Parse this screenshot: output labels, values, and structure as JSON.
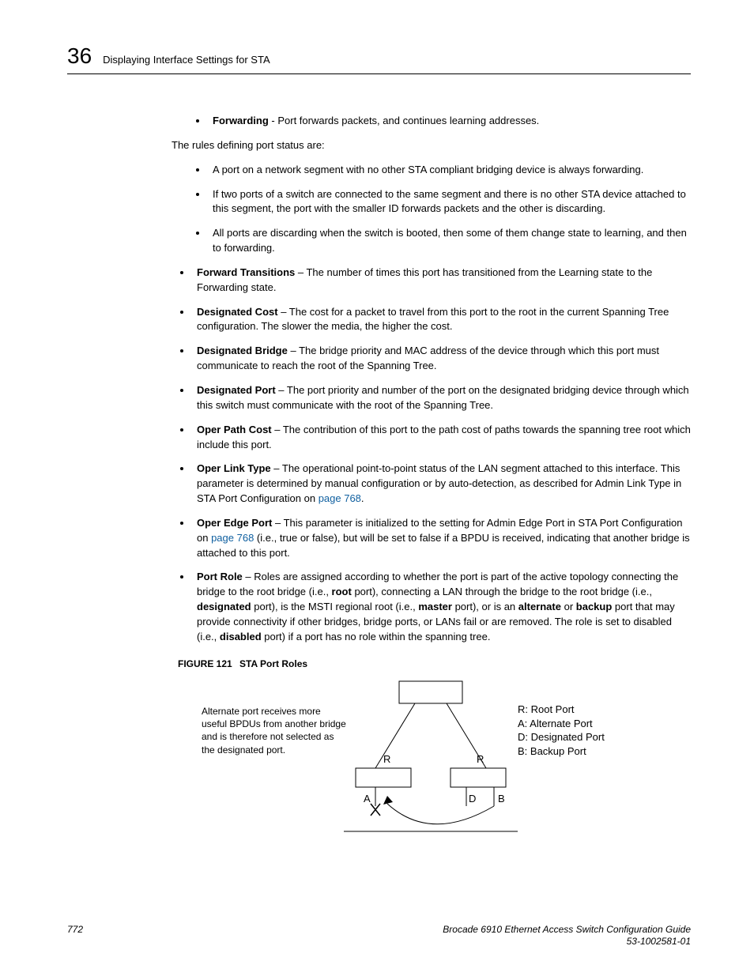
{
  "header": {
    "chapter_no": "36",
    "chapter_title": "Displaying Interface Settings for STA"
  },
  "body": {
    "forwarding_term": "Forwarding",
    "forwarding_desc": " - Port forwards packets, and continues learning addresses.",
    "rules_intro": "The rules defining port status are:",
    "rule1": "A port on a network segment with no other STA compliant bridging device is always forwarding.",
    "rule2": "If two ports of a switch are connected to the same segment and there is no other STA device attached to this segment, the port with the smaller ID forwards packets and the other is discarding.",
    "rule3": "All ports are discarding when the switch is booted, then some of them change state to learning, and then to forwarding.",
    "ft_term": "Forward Transitions",
    "ft_desc": " – The number of times this port has transitioned from the Learning state to the Forwarding state.",
    "dc_term": "Designated Cost",
    "dc_desc": " – The cost for a packet to travel from this port to the root in the current Spanning Tree configuration. The slower the media, the higher the cost.",
    "db_term": "Designated Bridge",
    "db_desc": " – The bridge priority and MAC address of the device through which this port must communicate to reach the root of the Spanning Tree.",
    "dp_term": "Designated Port",
    "dp_desc": " – The port priority and number of the port on the designated bridging device through which this switch must communicate with the root of the Spanning Tree.",
    "opc_term": "Oper Path Cost",
    "opc_desc": " – The contribution of this port to the path cost of paths towards the spanning tree root which include this port.",
    "olt_term": "Oper Link Type",
    "olt_desc1": " – The operational point-to-point status of the LAN segment attached to this interface. This parameter is determined by manual configuration or by auto-detection, as described for Admin Link Type in STA Port Configuration on ",
    "olt_link": "page 768",
    "olt_desc2": ".",
    "oep_term": "Oper Edge Port",
    "oep_desc1": " – This parameter is initialized to the setting for Admin Edge Port in STA Port Configuration on ",
    "oep_link": "page 768",
    "oep_desc2": " (i.e., true or false), but will be set to false if a BPDU is received, indicating that another bridge is attached to this port.",
    "pr_term": "Port Role",
    "pr_desc1": " – Roles are assigned according to whether the port is part of the active topology connecting the bridge to the root bridge (i.e., ",
    "pr_root": "root",
    "pr_desc2": " port), connecting a LAN through the bridge to the root bridge (i.e., ",
    "pr_designated": "designated",
    "pr_desc3": " port), is the MSTI regional root (i.e., ",
    "pr_master": "master",
    "pr_desc4": " port), or is an ",
    "pr_alternate": "alternate",
    "pr_desc5": " or ",
    "pr_backup": "backup",
    "pr_desc6": " port that may provide connectivity if other bridges, bridge ports, or LANs fail or are removed. The role is set to disabled (i.e., ",
    "pr_disabled": "disabled",
    "pr_desc7": " port) if a port has no role within the spanning tree."
  },
  "figure": {
    "label": "FIGURE 121",
    "title": "STA Port Roles",
    "left_note": "Alternate port receives more useful BPDUs from another bridge and is therefore not selected as the designated port.",
    "legend_r": "R: Root Port",
    "legend_a": "A: Alternate Port",
    "legend_d": "D: Designated Port",
    "legend_b": "B: Backup Port",
    "lbl_r": "R",
    "lbl_a": "A",
    "lbl_d": "D",
    "lbl_b": "B"
  },
  "footer": {
    "page_no": "772",
    "doc_title": "Brocade 6910 Ethernet Access Switch Configuration Guide",
    "doc_num": "53-1002581-01"
  }
}
